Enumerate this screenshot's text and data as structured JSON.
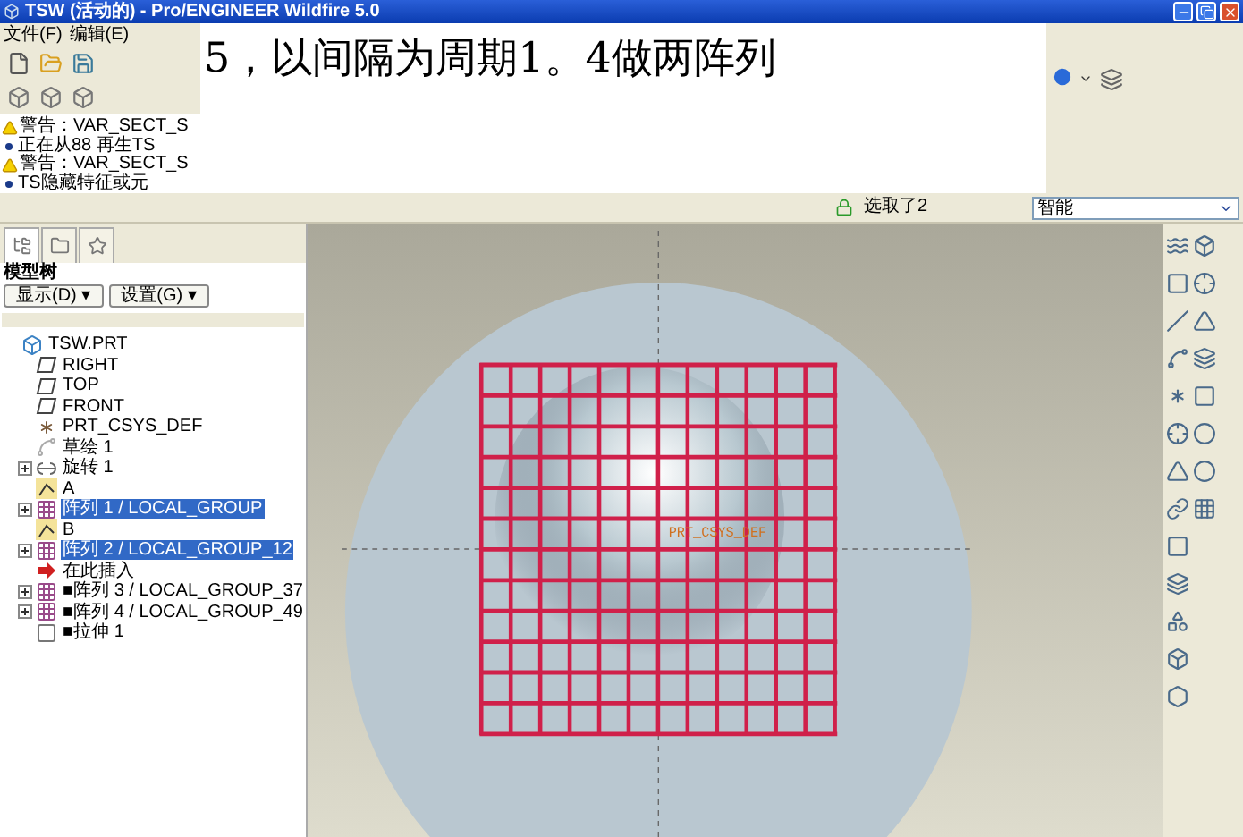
{
  "window": {
    "title": "TSW (活动的) - Pro/ENGINEER Wildfire 5.0"
  },
  "menu": [
    "文件(F)",
    "编辑(E)"
  ],
  "note": {
    "text": "5，以间隔为周期1。4做两阵列"
  },
  "messages": [
    {
      "kind": "warning",
      "text": "警告：VAR_SECT_S"
    },
    {
      "kind": "info",
      "text": "正在从88 再生TS"
    },
    {
      "kind": "warning",
      "text": "警告：VAR_SECT_S"
    },
    {
      "kind": "info",
      "text": "TS隐藏特征或元"
    }
  ],
  "status": {
    "selection": "选取了2",
    "filter": "智能"
  },
  "sidebar": {
    "tabs": [
      {
        "kind": "tree",
        "selected": true
      },
      {
        "kind": "folder",
        "selected": false
      },
      {
        "kind": "favorites",
        "selected": false
      }
    ],
    "title": "模型树",
    "buttons": [
      "显示(D) ▾",
      "设置(G) ▾"
    ]
  },
  "tree": {
    "label": "TSW.PRT",
    "kind": "part",
    "children": [
      {
        "label": "RIGHT",
        "kind": "plane",
        "selected": false
      },
      {
        "label": "TOP",
        "kind": "plane",
        "selected": false
      },
      {
        "label": "FRONT",
        "kind": "plane",
        "selected": false
      },
      {
        "label": "PRT_CSYS_DEF",
        "kind": "csys",
        "selected": false
      },
      {
        "label": "草绘 1",
        "kind": "sketch",
        "selected": false
      },
      {
        "label": "旋转 1",
        "kind": "revolve",
        "selected": false,
        "expanded": false
      },
      {
        "label": "A",
        "kind": "axis",
        "selected": false
      },
      {
        "label": "阵列 1 / LOCAL_GROUP",
        "kind": "pattern",
        "selected": true,
        "expanded": false
      },
      {
        "label": "B",
        "kind": "axis",
        "selected": false
      },
      {
        "label": "阵列 2 / LOCAL_GROUP_12",
        "kind": "pattern",
        "selected": true,
        "expanded": false
      },
      {
        "label": "在此插入",
        "kind": "insert",
        "selected": false
      },
      {
        "label": "■阵列 3 / LOCAL_GROUP_37",
        "kind": "pattern",
        "selected": false,
        "expanded": false
      },
      {
        "label": "■阵列 4 / LOCAL_GROUP_49",
        "kind": "pattern",
        "selected": false,
        "expanded": false
      },
      {
        "label": "■拉伸 1",
        "kind": "extrude",
        "selected": false
      }
    ]
  },
  "viewport": {
    "label": "PRT_CSYS_DEF"
  }
}
